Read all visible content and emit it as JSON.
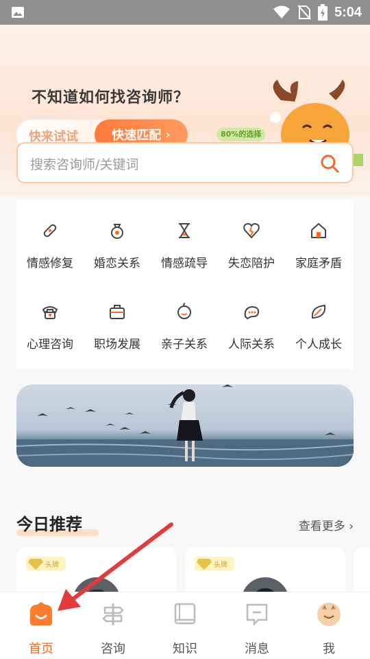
{
  "status_bar": {
    "time": "5:04"
  },
  "hero": {
    "title": "不知道如何找咨询师？",
    "pill_left": "快来试试",
    "pill_button": "快速匹配",
    "badge": "80%的选择"
  },
  "search": {
    "placeholder": "搜索咨询师/关键词"
  },
  "categories": [
    {
      "label": "情感修复",
      "icon": "bandage-icon"
    },
    {
      "label": "婚恋关系",
      "icon": "ring-icon"
    },
    {
      "label": "情感疏导",
      "icon": "hourglass-icon"
    },
    {
      "label": "失恋陪护",
      "icon": "broken-heart-icon"
    },
    {
      "label": "家庭矛盾",
      "icon": "home-icon"
    },
    {
      "label": "心理咨询",
      "icon": "phone-icon"
    },
    {
      "label": "职场发展",
      "icon": "briefcase-icon"
    },
    {
      "label": "亲子关系",
      "icon": "baby-icon"
    },
    {
      "label": "人际关系",
      "icon": "chat-icon"
    },
    {
      "label": "个人成长",
      "icon": "leaf-icon"
    }
  ],
  "recommend": {
    "title": "今日推荐",
    "see_more": "查看更多",
    "cards": [
      {
        "tag": "头牌"
      },
      {
        "tag": "头牌"
      }
    ]
  },
  "tabbar": {
    "items": [
      {
        "label": "首页",
        "icon": "home-smile-icon",
        "active": true
      },
      {
        "label": "咨询",
        "icon": "signpost-icon",
        "active": false
      },
      {
        "label": "知识",
        "icon": "book-icon",
        "active": false
      },
      {
        "label": "消息",
        "icon": "message-icon",
        "active": false
      },
      {
        "label": "我",
        "icon": "profile-avatar-icon",
        "active": false
      }
    ]
  },
  "colors": {
    "accent": "#ff6a1a",
    "search_border": "#f9c9a4"
  }
}
